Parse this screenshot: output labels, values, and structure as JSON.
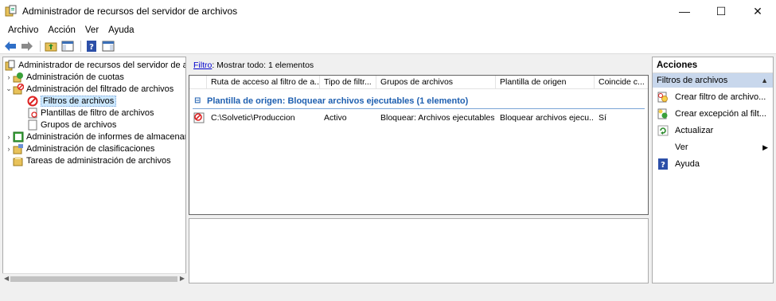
{
  "window": {
    "title": "Administrador de recursos del servidor de archivos",
    "controls": {
      "minimize": "—",
      "maximize": "☐",
      "close": "✕"
    }
  },
  "menu": [
    "Archivo",
    "Acción",
    "Ver",
    "Ayuda"
  ],
  "toolbar": {
    "buttons": [
      "back-icon",
      "forward-icon",
      "up-folder-icon",
      "show-hide-tree-icon",
      "help-icon",
      "show-hide-actions-icon"
    ]
  },
  "tree": {
    "root": "Administrador de recursos del servidor de arch",
    "items": [
      {
        "label": "Administración de cuotas",
        "icon": "quota-icon"
      },
      {
        "label": "Administración del filtrado de archivos",
        "icon": "screen-icon"
      },
      {
        "label": "Filtros de archivos",
        "icon": "block-icon",
        "selected": true
      },
      {
        "label": "Plantillas de filtro de archivos",
        "icon": "template-icon"
      },
      {
        "label": "Grupos de archivos",
        "icon": "file-group-icon"
      },
      {
        "label": "Administración de informes de almacenam",
        "icon": "report-icon"
      },
      {
        "label": "Administración de clasificaciones",
        "icon": "classification-icon"
      },
      {
        "label": "Tareas de administración de archivos",
        "icon": "task-icon"
      }
    ]
  },
  "filter": {
    "link": "Filtro",
    "text": ": Mostrar todo: 1 elementos"
  },
  "columns": [
    "Ruta de acceso al filtro de a...",
    "Tipo de filtr...",
    "Grupos de archivos",
    "Plantilla de origen",
    "Coincide c..."
  ],
  "group": {
    "toggle": "⊟",
    "label": "Plantilla de origen: Bloquear archivos ejecutables (1 elemento)"
  },
  "rows": [
    {
      "path": "C:\\Solvetic\\Produccion",
      "type": "Activo",
      "groups": "Bloquear: Archivos ejecutables",
      "template": "Bloquear archivos ejecu...",
      "matches": "Sí"
    }
  ],
  "actions": {
    "header": "Acciones",
    "section": "Filtros de archivos",
    "items": [
      {
        "label": "Crear filtro de archivo...",
        "icon": "create-screen-icon"
      },
      {
        "label": "Crear excepción al filt...",
        "icon": "create-exception-icon"
      },
      {
        "label": "Actualizar",
        "icon": "refresh-icon"
      },
      {
        "label": "Ver",
        "icon": "",
        "submenu": true
      },
      {
        "label": "Ayuda",
        "icon": "help-icon"
      }
    ]
  },
  "colors": {
    "accent": "#1e5fb0",
    "selection": "#cce8ff",
    "section_bg": "#c8d7ec"
  }
}
